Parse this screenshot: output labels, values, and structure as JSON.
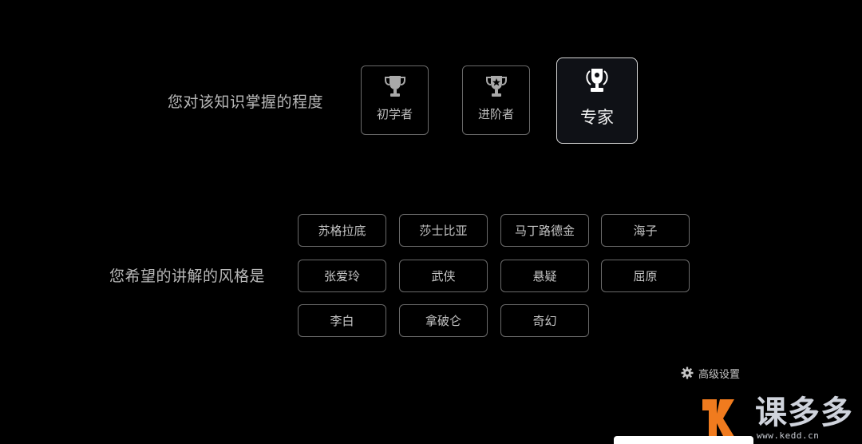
{
  "knowledge": {
    "question": "您对该知识掌握的程度",
    "levels": [
      {
        "label": "初学者",
        "icon": "trophy-icon",
        "selected": false
      },
      {
        "label": "进阶者",
        "icon": "trophy-star-icon",
        "selected": false
      },
      {
        "label": "专家",
        "icon": "trophy-laurel-icon",
        "selected": true
      }
    ]
  },
  "style": {
    "question": "您希望的讲解的风格是",
    "options": [
      "苏格拉底",
      "莎士比亚",
      "马丁路德金",
      "海子",
      "张爱玲",
      "武侠",
      "悬疑",
      "屈原",
      "李白",
      "拿破仑",
      "奇幻"
    ]
  },
  "advanced": {
    "label": "高级设置",
    "icon": "gear-icon"
  },
  "watermark": {
    "brand": "课多多",
    "url": "www.kedd.cn",
    "accent": "#f07b1e"
  }
}
